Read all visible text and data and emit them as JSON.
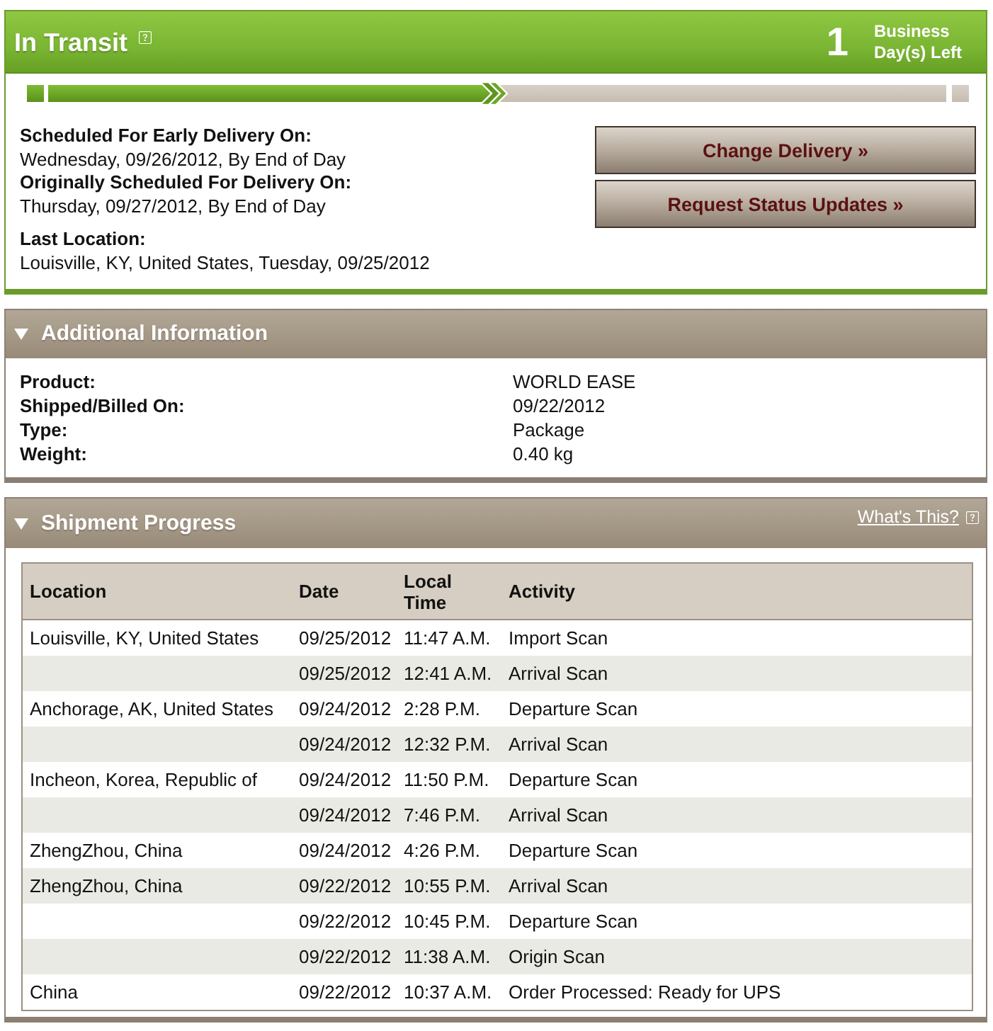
{
  "status_panel": {
    "title": "In Transit",
    "days_left": {
      "count": "1",
      "label": "Business Day(s) Left"
    },
    "progress": {
      "level": 0.5
    },
    "delivery_dates": [
      {
        "label": "Scheduled For Early Delivery On:",
        "value": "Wednesday, 09/26/2012, By End of Day"
      },
      {
        "label": "Originally Scheduled For Delivery On:",
        "value": "Thursday, 09/27/2012, By End of Day"
      }
    ],
    "last_location": {
      "label": "Last Location:",
      "value": "Louisville, KY, United States, Tuesday, 09/25/2012"
    },
    "buttons": [
      "Change Delivery »",
      "Request Status Updates »"
    ]
  },
  "additional_information": {
    "title": "Additional Information",
    "expanded": true,
    "rows": [
      {
        "label": "Product:",
        "value": "WORLD EASE"
      },
      {
        "label": "Shipped/Billed On:",
        "value": "09/22/2012"
      },
      {
        "label": "Type:",
        "value": "Package"
      },
      {
        "label": "Weight:",
        "value": "0.40 kg"
      }
    ]
  },
  "shipment_progress": {
    "title": "Shipment Progress",
    "expanded": true,
    "help_link": "What's This?",
    "table": {
      "columns": [
        "Location",
        "Date",
        "Local Time",
        "Activity"
      ],
      "rows": [
        {
          "location": "Louisville, KY, United States",
          "date": "09/25/2012",
          "time": "11:47 A.M.",
          "activity": "Import Scan"
        },
        {
          "date": "09/25/2012",
          "time": "12:41 A.M.",
          "activity": "Arrival Scan"
        },
        {
          "location": "Anchorage, AK, United States",
          "date": "09/24/2012",
          "time": "2:28 P.M.",
          "activity": "Departure Scan"
        },
        {
          "date": "09/24/2012",
          "time": "12:32 P.M.",
          "activity": "Arrival Scan"
        },
        {
          "location": "Incheon, Korea, Republic of",
          "date": "09/24/2012",
          "time": "11:50 P.M.",
          "activity": "Departure Scan"
        },
        {
          "date": "09/24/2012",
          "time": "7:46 P.M.",
          "activity": "Arrival Scan"
        },
        {
          "location": "ZhengZhou, China",
          "date": "09/24/2012",
          "time": "4:26 P.M.",
          "activity": "Departure Scan"
        },
        {
          "location": "ZhengZhou, China",
          "date": "09/22/2012",
          "time": "10:55 P.M.",
          "activity": "Arrival Scan"
        },
        {
          "date": "09/22/2012",
          "time": "10:45 P.M.",
          "activity": "Departure Scan"
        },
        {
          "date": "09/22/2012",
          "time": "11:38 A.M.",
          "activity": "Origin Scan"
        },
        {
          "location": "China",
          "date": "09/22/2012",
          "time": "10:37 A.M.",
          "activity": "Order Processed: Ready for UPS"
        }
      ]
    }
  }
}
